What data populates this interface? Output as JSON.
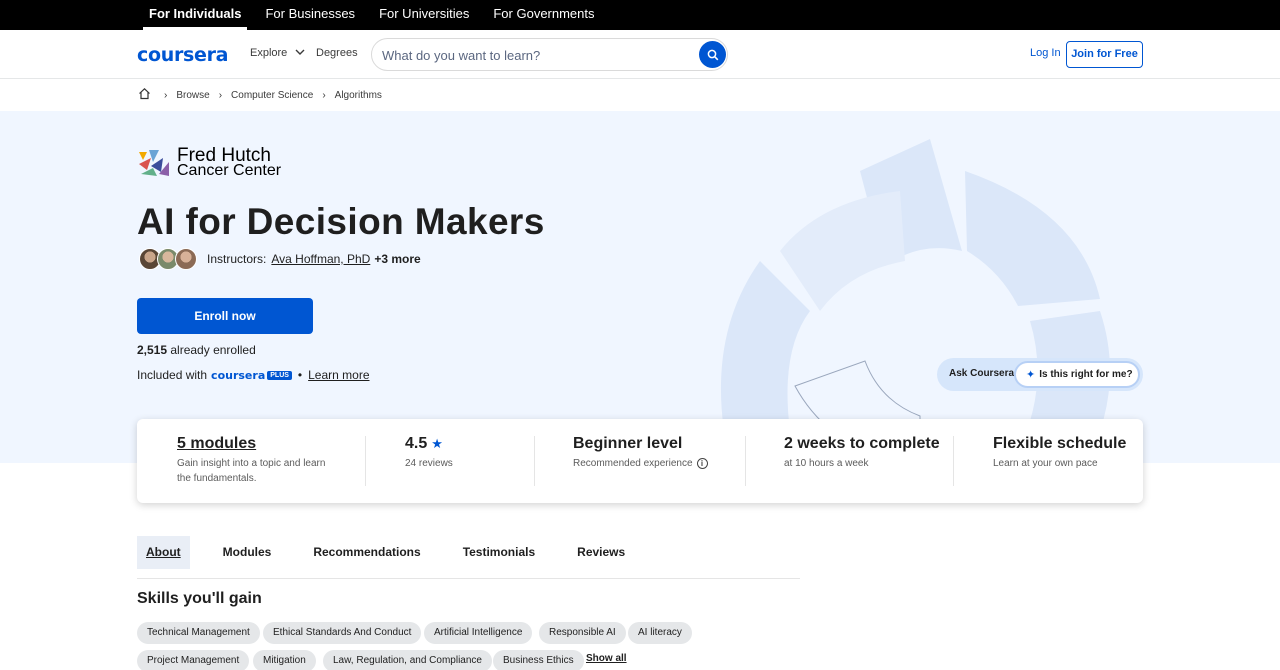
{
  "audience_tabs": [
    "For Individuals",
    "For Businesses",
    "For Universities",
    "For Governments"
  ],
  "header": {
    "logo": "coursera",
    "explore": "Explore",
    "degrees": "Degrees",
    "search_placeholder": "What do you want to learn?",
    "login": "Log In",
    "join": "Join for Free"
  },
  "breadcrumbs": [
    "Browse",
    "Computer Science",
    "Algorithms"
  ],
  "partner": {
    "name_line1": "Fred Hutch",
    "name_line2": "Cancer Center"
  },
  "course": {
    "title": "AI for Decision Makers",
    "instructors_label": "Instructors:",
    "instructor_name": "Ava Hoffman, PhD",
    "instructor_more": "+3 more",
    "enroll": "Enroll now",
    "enrolled_count": "2,515",
    "enrolled_suffix": "already enrolled",
    "included_prefix": "Included with",
    "plus_word": "coursera",
    "plus_badge": "PLUS",
    "bullet": "•",
    "learn_more": "Learn more"
  },
  "ask": {
    "label": "Ask Coursera",
    "button": "Is this right for me?"
  },
  "info": {
    "modules_title": "5 modules",
    "modules_desc": "Gain insight into a topic and learn the fundamentals.",
    "rating": "4.5",
    "reviews": "24 reviews",
    "level": "Beginner level",
    "level_sub": "Recommended experience",
    "duration": "2 weeks to complete",
    "duration_sub": "at 10 hours a week",
    "schedule": "Flexible schedule",
    "schedule_sub": "Learn at your own pace"
  },
  "tabs": [
    "About",
    "Modules",
    "Recommendations",
    "Testimonials",
    "Reviews"
  ],
  "skills": {
    "heading": "Skills you'll gain",
    "row1": [
      "Technical Management",
      "Ethical Standards And Conduct",
      "Artificial Intelligence",
      "Responsible AI",
      "AI literacy"
    ],
    "row2": [
      "Project Management",
      "Mitigation",
      "Law, Regulation, and Compliance",
      "Business Ethics"
    ],
    "show_all": "Show all"
  },
  "colors": {
    "brand": "#0056d2",
    "hero_bg": "#f0f6ff"
  }
}
